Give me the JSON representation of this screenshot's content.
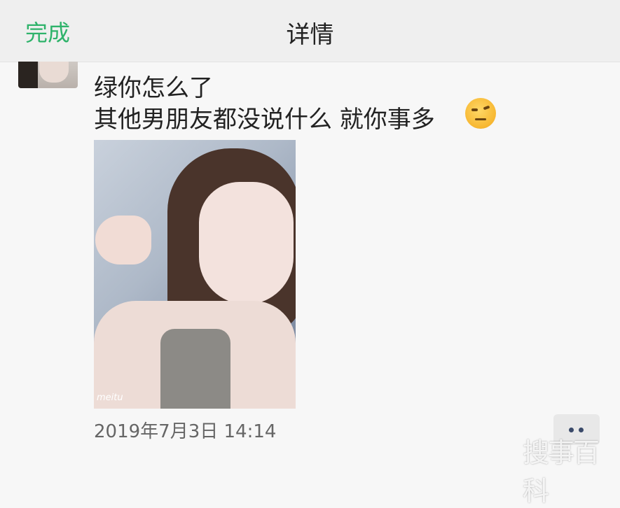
{
  "nav": {
    "done_label": "完成",
    "title": "详情"
  },
  "post": {
    "text_line1": "绿你怎么了",
    "text_line2": "其他男朋友都没说什么 就你事多",
    "emoji_icon": "smirk-face-icon",
    "photo_watermark": "meitu",
    "timestamp": "2019年7月3日 14:14"
  },
  "actions": {
    "more_icon": "two-dots-more-icon"
  },
  "watermark": {
    "text": "搜事百科"
  },
  "colors": {
    "accent": "#2fb36b",
    "nav_bg": "#efefef",
    "page_bg": "#f7f7f7",
    "dots": "#3a4a6a"
  }
}
